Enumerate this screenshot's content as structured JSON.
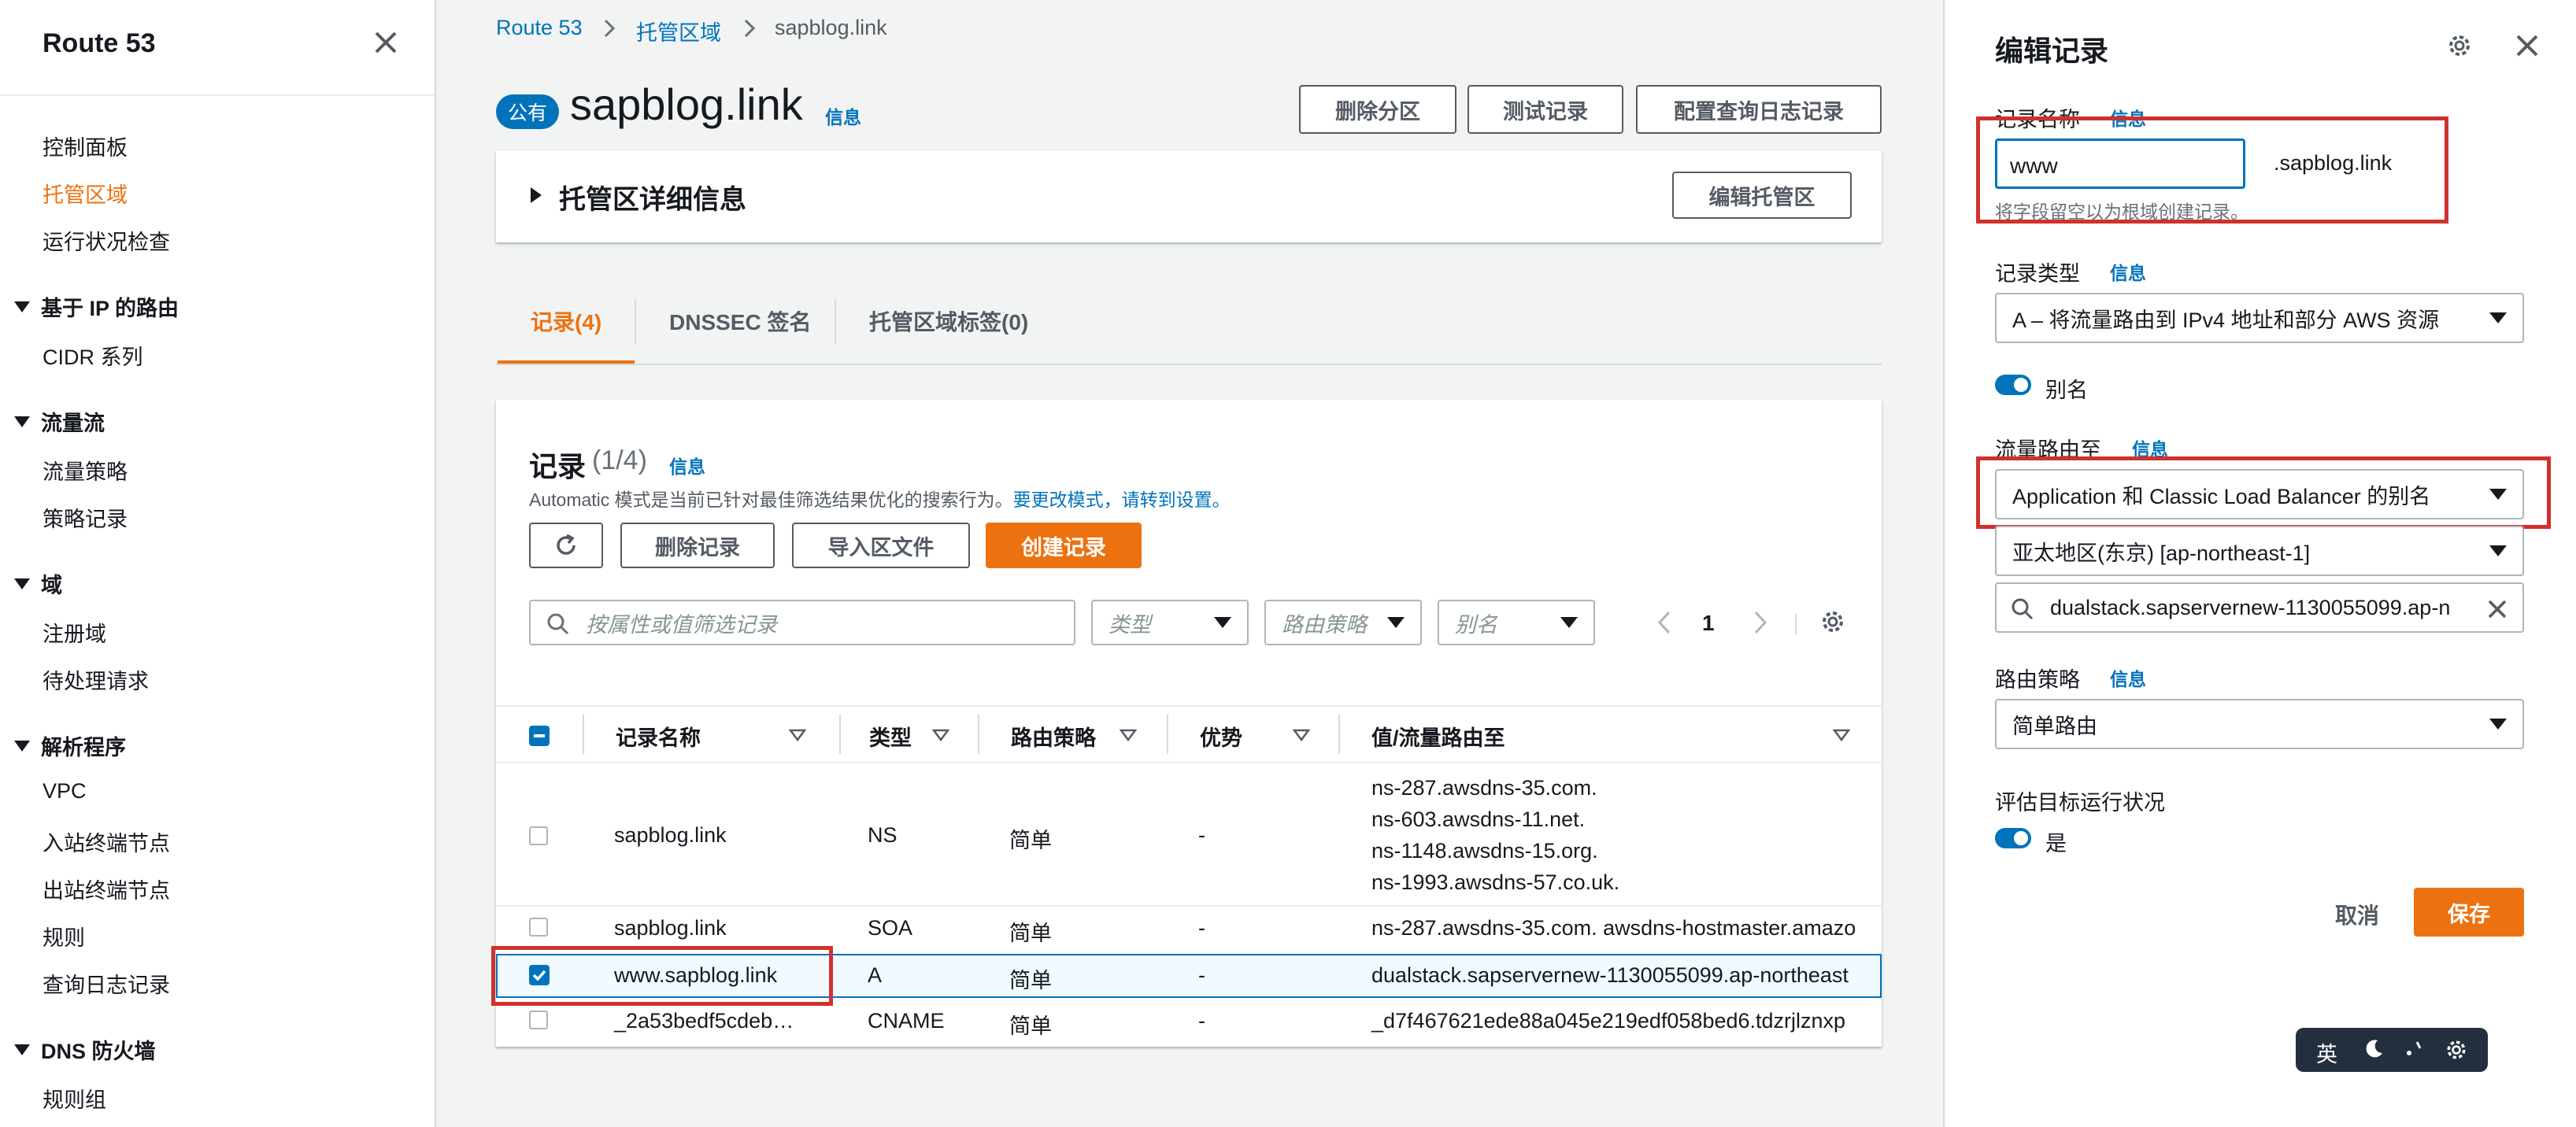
{
  "sidebar": {
    "title": "Route 53",
    "items": [
      "控制面板",
      "托管区域",
      "运行状况检查"
    ],
    "sections": [
      {
        "label": "基于 IP 的路由",
        "items": [
          "CIDR 系列"
        ]
      },
      {
        "label": "流量流",
        "items": [
          "流量策略",
          "策略记录"
        ]
      },
      {
        "label": "域",
        "items": [
          "注册域",
          "待处理请求"
        ]
      },
      {
        "label": "解析程序",
        "items": [
          "VPC",
          "入站终端节点",
          "出站终端节点",
          "规则",
          "查询日志记录"
        ]
      },
      {
        "label": "DNS 防火墙",
        "items": [
          "规则组"
        ]
      }
    ]
  },
  "breadcrumb": [
    "Route 53",
    "托管区域",
    "sapblog.link"
  ],
  "zone": {
    "badge": "公有",
    "name": "sapblog.link",
    "info": "信息",
    "buttons": [
      "删除分区",
      "测试记录",
      "配置查询日志记录"
    ],
    "details_label": "托管区详细信息",
    "edit_zone": "编辑托管区"
  },
  "tabs": [
    "记录(4)",
    "DNSSEC 签名",
    "托管区域标签(0)"
  ],
  "records": {
    "title": "记录",
    "count": "(1/4)",
    "info": "信息",
    "desc": "Automatic 模式是当前已针对最佳筛选结果优化的搜索行为。",
    "desc_link": "要更改模式，请转到设置。",
    "buttons": {
      "delete": "删除记录",
      "import": "导入区文件",
      "create": "创建记录"
    },
    "filter_placeholder": "按属性或值筛选记录",
    "filters": [
      "类型",
      "路由策略",
      "别名"
    ],
    "page": "1",
    "columns": [
      "记录名称",
      "类型",
      "路由策略",
      "优势",
      "值/流量路由至"
    ],
    "rows": [
      {
        "name": "sapblog.link",
        "type": "NS",
        "policy": "简单",
        "diff": "-",
        "values": [
          "ns-287.awsdns-35.com.",
          "ns-603.awsdns-11.net.",
          "ns-1148.awsdns-15.org.",
          "ns-1993.awsdns-57.co.uk."
        ],
        "checked": false
      },
      {
        "name": "sapblog.link",
        "type": "SOA",
        "policy": "简单",
        "diff": "-",
        "values": [
          "ns-287.awsdns-35.com. awsdns-hostmaster.amazo"
        ],
        "checked": false
      },
      {
        "name": "www.sapblog.link",
        "type": "A",
        "policy": "简单",
        "diff": "-",
        "values": [
          "dualstack.sapservernew-1130055099.ap-northeast"
        ],
        "checked": true
      },
      {
        "name": "_2a53bedf5cdeb…",
        "type": "CNAME",
        "policy": "简单",
        "diff": "-",
        "values": [
          "_d7f467621ede88a045e219edf058bed6.tdzrjlznxp"
        ],
        "checked": false
      }
    ]
  },
  "panel": {
    "title": "编辑记录",
    "info": "信息",
    "record_name_label": "记录名称",
    "record_name_value": "www",
    "domain_suffix": ".sapblog.link",
    "record_name_hint": "将字段留空以为根域创建记录。",
    "record_type_label": "记录类型",
    "record_type_value": "A – 将流量路由到 IPv4 地址和部分 AWS 资源",
    "alias_label": "别名",
    "route_to_label": "流量路由至",
    "route_to_value": "Application 和 Classic Load Balancer 的别名",
    "region_value": "亚太地区(东京) [ap-northeast-1]",
    "lb_value": "dualstack.sapservernew-1130055099.ap-n",
    "routing_policy_label": "路由策略",
    "routing_policy_value": "简单路由",
    "health_label": "评估目标运行状况",
    "health_value": "是",
    "cancel": "取消",
    "save": "保存"
  },
  "ime": {
    "lang": "英"
  },
  "colors": {
    "accent": "#ec7211",
    "link": "#0073bb",
    "highlight": "#d0312d"
  }
}
